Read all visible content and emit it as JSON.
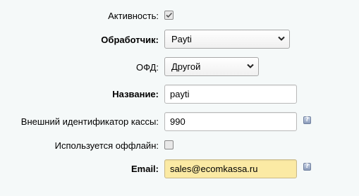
{
  "form": {
    "active": {
      "label": "Активность:",
      "checked": true
    },
    "handler": {
      "label": "Обработчик:",
      "value": "Payti"
    },
    "ofd": {
      "label": "ОФД:",
      "value": "Другой"
    },
    "name": {
      "label": "Название:",
      "value": "payti"
    },
    "external_id": {
      "label": "Внешний идентификатор кассы:",
      "value": "990",
      "help": "?"
    },
    "offline": {
      "label": "Используется оффлайн:",
      "checked": false
    },
    "email": {
      "label": "Email:",
      "value": "sales@ecomkassa.ru",
      "help": "?"
    }
  },
  "colors": {
    "background": "#f5f9f9",
    "email_highlight": "#fbeaa4",
    "help_icon": "#8b9cbb"
  }
}
